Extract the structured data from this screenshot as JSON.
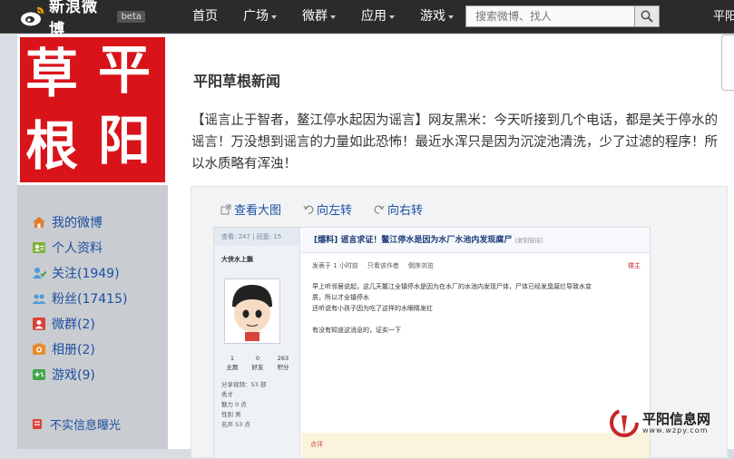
{
  "header": {
    "brand": "新浪微博",
    "beta_label": "beta",
    "nav": [
      {
        "label": "首页",
        "has_menu": false
      },
      {
        "label": "广场",
        "has_menu": true
      },
      {
        "label": "微群",
        "has_menu": true
      },
      {
        "label": "应用",
        "has_menu": true
      },
      {
        "label": "游戏",
        "has_menu": true
      }
    ],
    "search_placeholder": "搜索微博、找人",
    "user_name": "平阳"
  },
  "profile": {
    "seal_chars": [
      "草",
      "平",
      "根",
      "阳"
    ]
  },
  "sidebar": {
    "items": [
      {
        "label": "我的微博",
        "icon": "home-icon",
        "color": "#e07b2e"
      },
      {
        "label": "个人资料",
        "icon": "profile-card-icon",
        "color": "#7fb33f"
      },
      {
        "label": "关注(1949)",
        "icon": "follow-icon",
        "color": "#4f9ad8"
      },
      {
        "label": "粉丝(17415)",
        "icon": "fans-icon",
        "color": "#4f9ad8"
      },
      {
        "label": "微群(2)",
        "icon": "group-icon",
        "color": "#d8443a"
      },
      {
        "label": "相册(2)",
        "icon": "album-icon",
        "color": "#e88a2a"
      },
      {
        "label": "游戏(9)",
        "icon": "game-icon",
        "color": "#3fa64a"
      }
    ],
    "report_label": "不实信息曝光"
  },
  "main": {
    "title": "平阳草根新闻",
    "post_text": "【谣言止于智者，鳌江停水起因为谣言】网友黑米：今天听接到几个电话，都是关于停水的谣言！万没想到谣言的力量如此恐怖！最近水浑只是因为沉淀池清洗，少了过滤的程序！所以水质略有浑浊！",
    "media_actions": {
      "view_large": "查看大图",
      "rotate_left": "向左转",
      "rotate_right": "向右转"
    },
    "forum_screenshot": {
      "stats": "查看: 247 | 回复: 15",
      "user": "大侠水上飘",
      "nums": [
        {
          "value": "1",
          "label": "主题"
        },
        {
          "value": "0",
          "label": "好友"
        },
        {
          "value": "263",
          "label": "积分"
        }
      ],
      "share": "分享视频：53 部",
      "rank": "秀才",
      "details": [
        "魅力 0 点",
        "性别 男",
        "名声 53 点"
      ],
      "title": "[爆料] 谣言求证！鳌江停水是因为水厂水池内发现腐尸",
      "title_tag": "[复制链接]",
      "meta": [
        "发表于 1 小时前",
        "只看该作者",
        "倒序浏览"
      ],
      "floor": "楼主",
      "body": [
        "早上听邻居说起，这几天鳌江全镇停水是因为在水厂的水池内发现尸体，尸体已经发臭腐烂导致水变",
        "质，所以才全镇停水",
        "还听说有小孩子因为吃了这样的水眼睛发红",
        "",
        "有没有知道这消息的，证实一下"
      ],
      "footer": "点评"
    }
  },
  "watermark": {
    "name": "平阳信息网",
    "url": "www.wzpy.com"
  }
}
